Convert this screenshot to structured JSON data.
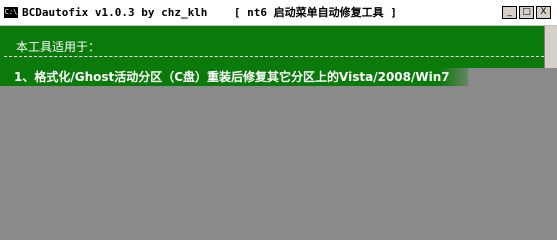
{
  "window": {
    "icon_text": "C:\\",
    "title": "BCDautofix v1.0.3 by chz_klh    [ nt6 启动菜单自动修复工具 ]",
    "minimize": "_",
    "maximize": "□",
    "close": "X"
  },
  "console": {
    "intro": "本工具适用于：",
    "item1": "1、格式化/Ghost活动分区（C盘）重装后修复其它分区上的Vista/2008/Win7"
  }
}
